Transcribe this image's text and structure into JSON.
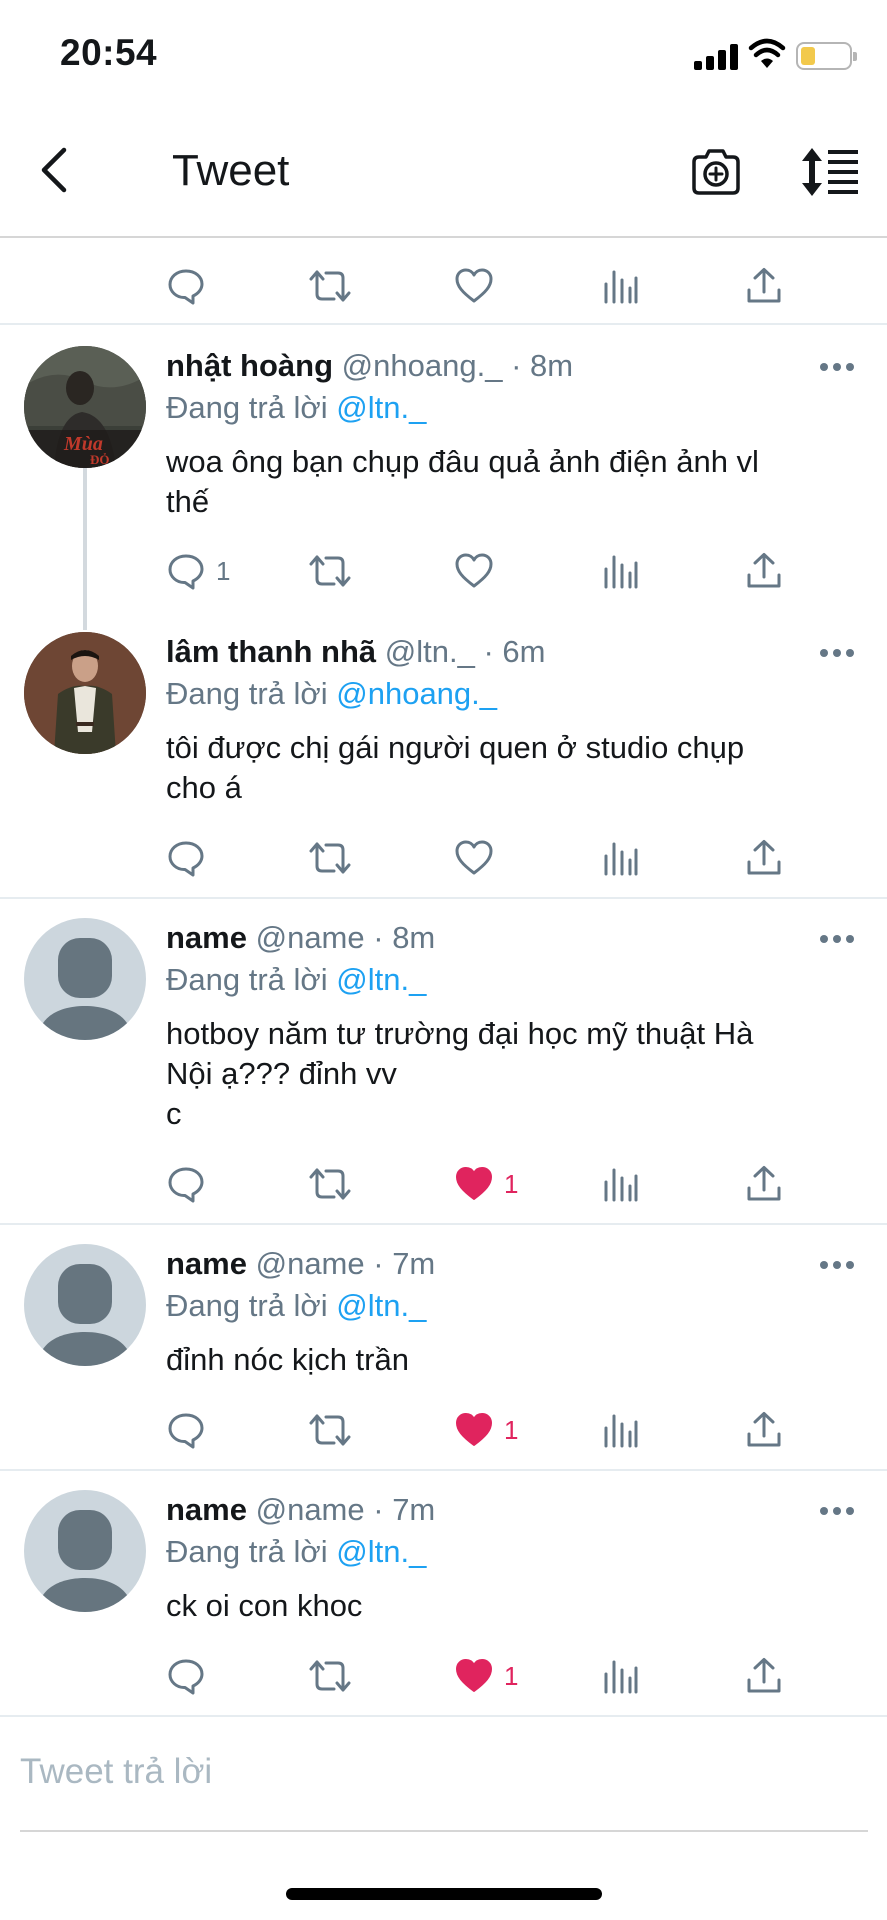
{
  "status_bar": {
    "time": "20:54",
    "battery_color": "#f2c94c"
  },
  "header": {
    "title": "Tweet",
    "back_icon": "chevron-left-icon",
    "camera_icon": "camera-icon",
    "sort_icon": "sort-icon"
  },
  "colors": {
    "link": "#1da1f2",
    "muted": "#657786",
    "like": "#e0245e",
    "text": "#14171a"
  },
  "tweets": [
    {
      "name": "nhật hoàng",
      "handle": "@nhoang._",
      "time": "8m",
      "reply_prefix": "Đang trả lời",
      "reply_to": "@ltn._",
      "text": "woa ông bạn chụp đâu quả ảnh điện ảnh vl\nthế",
      "reply_count": "1",
      "like_count": "",
      "liked": false
    },
    {
      "name": "lâm thanh nhã",
      "handle": "@ltn._",
      "time": "6m",
      "reply_prefix": "Đang trả lời",
      "reply_to": "@nhoang._",
      "text": "tôi được chị gái người quen ở studio chụp\ncho á",
      "reply_count": "",
      "like_count": "",
      "liked": false
    },
    {
      "name": "name",
      "handle": "@name",
      "time": "8m",
      "reply_prefix": "Đang trả lời",
      "reply_to": "@ltn._",
      "text": "hotboy năm tư trường đại học mỹ thuật Hà\nNội ạ??? đỉnh vv\nc",
      "reply_count": "",
      "like_count": "1",
      "liked": true
    },
    {
      "name": "name",
      "handle": "@name",
      "time": "7m",
      "reply_prefix": "Đang trả lời",
      "reply_to": "@ltn._",
      "text": "đỉnh nóc kịch trần",
      "reply_count": "",
      "like_count": "1",
      "liked": true
    },
    {
      "name": "name",
      "handle": "@name",
      "time": "7m",
      "reply_prefix": "Đang trả lời",
      "reply_to": "@ltn._",
      "text": "ck oi con khoc",
      "reply_count": "",
      "like_count": "1",
      "liked": true
    }
  ],
  "action_icons": [
    "reply-icon",
    "retweet-icon",
    "like-icon",
    "analytics-icon",
    "share-icon"
  ],
  "composer": {
    "placeholder": "Tweet trả lời"
  }
}
